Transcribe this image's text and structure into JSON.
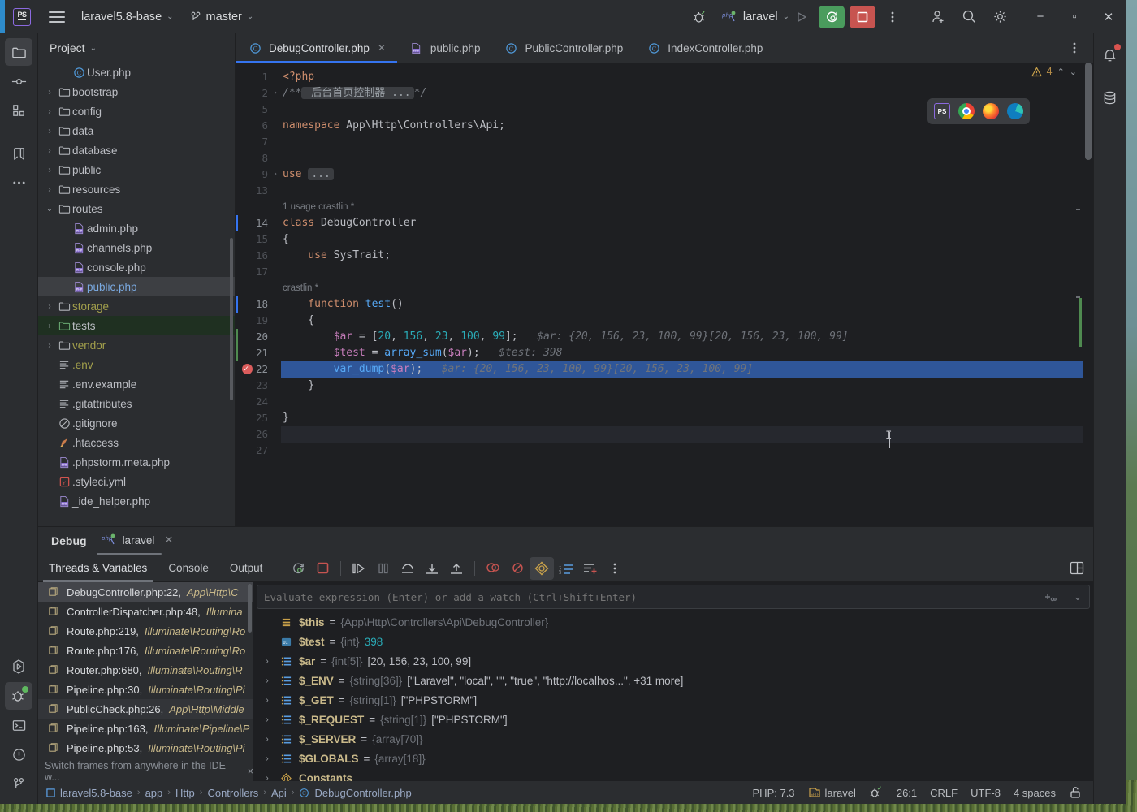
{
  "titlebar": {
    "project_name": "laravel5.8-base",
    "branch": "master",
    "run_config": "laravel",
    "icons": {
      "app_logo": "phpstorm-logo-icon",
      "menu": "hamburger-menu-icon",
      "vcs_branch": "git-branch-icon",
      "debug_settings": "debug-bug-icon",
      "run": "run-icon",
      "rerun_debug": "rerun-debug-icon",
      "stop": "stop-icon",
      "more": "more-vertical-icon",
      "add_user": "add-user-icon",
      "search": "search-icon",
      "settings": "gear-icon",
      "minimize": "minimize-icon",
      "maximize": "maximize-icon",
      "close": "close-icon"
    }
  },
  "left_toolbar": [
    {
      "name": "project",
      "icon": "folder-icon",
      "active": true
    },
    {
      "name": "commit",
      "icon": "commit-icon",
      "active": false
    },
    {
      "name": "structure",
      "icon": "structure-icon",
      "active": false
    },
    {
      "name": "bookmarks",
      "icon": "bookmark-icon",
      "active": false
    },
    {
      "name": "more-tool-windows",
      "icon": "ellipsis-icon",
      "active": false
    }
  ],
  "left_toolbar_bottom": [
    {
      "name": "run",
      "icon": "run-polygon-icon",
      "active": false
    },
    {
      "name": "debug",
      "icon": "debug-bug-icon",
      "active": true
    },
    {
      "name": "terminal",
      "icon": "terminal-icon",
      "active": false
    },
    {
      "name": "problems",
      "icon": "warning-circle-icon",
      "active": false
    },
    {
      "name": "version-control",
      "icon": "git-branch-icon",
      "active": false
    }
  ],
  "right_toolbar": [
    {
      "name": "notifications",
      "icon": "bell-icon"
    },
    {
      "name": "database",
      "icon": "database-icon"
    }
  ],
  "project_panel": {
    "title": "Project",
    "tree": [
      {
        "label": "User.php",
        "indent": 2,
        "arrow": "",
        "icon": "php-class-icon",
        "color": "plain",
        "state": ""
      },
      {
        "label": "bootstrap",
        "indent": 1,
        "arrow": "›",
        "icon": "folder-icon",
        "color": "plain",
        "state": ""
      },
      {
        "label": "config",
        "indent": 1,
        "arrow": "›",
        "icon": "folder-icon",
        "color": "plain",
        "state": ""
      },
      {
        "label": "data",
        "indent": 1,
        "arrow": "›",
        "icon": "folder-icon",
        "color": "plain",
        "state": ""
      },
      {
        "label": "database",
        "indent": 1,
        "arrow": "›",
        "icon": "folder-icon",
        "color": "plain",
        "state": ""
      },
      {
        "label": "public",
        "indent": 1,
        "arrow": "›",
        "icon": "folder-icon",
        "color": "plain",
        "state": ""
      },
      {
        "label": "resources",
        "indent": 1,
        "arrow": "›",
        "icon": "folder-icon",
        "color": "plain",
        "state": ""
      },
      {
        "label": "routes",
        "indent": 1,
        "arrow": "⌄",
        "icon": "folder-icon",
        "color": "plain",
        "state": ""
      },
      {
        "label": "admin.php",
        "indent": 2,
        "arrow": "",
        "icon": "php-file-icon",
        "color": "plain",
        "state": ""
      },
      {
        "label": "channels.php",
        "indent": 2,
        "arrow": "",
        "icon": "php-file-icon",
        "color": "plain",
        "state": ""
      },
      {
        "label": "console.php",
        "indent": 2,
        "arrow": "",
        "icon": "php-file-icon",
        "color": "plain",
        "state": ""
      },
      {
        "label": "public.php",
        "indent": 2,
        "arrow": "",
        "icon": "php-file-icon",
        "color": "blue",
        "state": "sel"
      },
      {
        "label": "storage",
        "indent": 1,
        "arrow": "›",
        "icon": "folder-icon",
        "color": "olive",
        "state": ""
      },
      {
        "label": "tests",
        "indent": 1,
        "arrow": "›",
        "icon": "folder-green-icon",
        "color": "plain",
        "state": "green-hl"
      },
      {
        "label": "vendor",
        "indent": 1,
        "arrow": "›",
        "icon": "folder-icon",
        "color": "olive",
        "state": ""
      },
      {
        "label": ".env",
        "indent": 1,
        "arrow": "",
        "icon": "text-file-icon",
        "color": "olive",
        "state": ""
      },
      {
        "label": ".env.example",
        "indent": 1,
        "arrow": "",
        "icon": "text-file-icon",
        "color": "plain",
        "state": ""
      },
      {
        "label": ".gitattributes",
        "indent": 1,
        "arrow": "",
        "icon": "text-file-icon",
        "color": "plain",
        "state": ""
      },
      {
        "label": ".gitignore",
        "indent": 1,
        "arrow": "",
        "icon": "gitignore-icon",
        "color": "plain",
        "state": ""
      },
      {
        "label": ".htaccess",
        "indent": 1,
        "arrow": "",
        "icon": "htaccess-icon",
        "color": "plain",
        "state": ""
      },
      {
        "label": ".phpstorm.meta.php",
        "indent": 1,
        "arrow": "",
        "icon": "php-file-icon",
        "color": "plain",
        "state": ""
      },
      {
        "label": ".styleci.yml",
        "indent": 1,
        "arrow": "",
        "icon": "yaml-file-icon",
        "color": "plain",
        "state": ""
      },
      {
        "label": "_ide_helper.php",
        "indent": 1,
        "arrow": "",
        "icon": "php-file-icon",
        "color": "plain",
        "state": ""
      }
    ]
  },
  "editor": {
    "tabs": [
      {
        "label": "DebugController.php",
        "icon": "php-class-icon",
        "active": true,
        "closable": true
      },
      {
        "label": "public.php",
        "icon": "php-file-icon",
        "active": false,
        "closable": false
      },
      {
        "label": "PublicController.php",
        "icon": "php-class-icon",
        "active": false,
        "closable": false
      },
      {
        "label": "IndexController.php",
        "icon": "php-class-icon",
        "active": false,
        "closable": false
      }
    ],
    "inspection_count": "4",
    "inspection_icon": "warning-triangle-icon",
    "browser_popup": [
      "phpstorm-icon",
      "chrome-icon",
      "firefox-icon",
      "edge-icon"
    ],
    "lines": [
      {
        "no": "1",
        "fold": "",
        "segments": [
          {
            "t": "<?php",
            "c": "kw"
          }
        ]
      },
      {
        "no": "2",
        "fold": "›",
        "segments": [
          {
            "t": "/**",
            "c": "cmt"
          },
          {
            "t": " 后台首页控制器 ...",
            "c": "foldbadge"
          },
          {
            "t": "*/",
            "c": "cmt"
          }
        ]
      },
      {
        "no": "5",
        "fold": "",
        "segments": []
      },
      {
        "no": "6",
        "fold": "",
        "segments": [
          {
            "t": "namespace ",
            "c": "kw"
          },
          {
            "t": "App\\Http\\Controllers\\Api;",
            "c": "plain"
          }
        ]
      },
      {
        "no": "7",
        "fold": "",
        "segments": []
      },
      {
        "no": "8",
        "fold": "",
        "segments": []
      },
      {
        "no": "9",
        "fold": "›",
        "segments": [
          {
            "t": "use ",
            "c": "kw"
          },
          {
            "t": "...",
            "c": "foldbadge"
          }
        ]
      },
      {
        "no": "13",
        "fold": "",
        "segments": []
      },
      {
        "no": "",
        "fold": "",
        "annot": "1 usage    crastlin *"
      },
      {
        "no": "14",
        "fold": "",
        "mark": "blue",
        "segments": [
          {
            "t": "class ",
            "c": "kw"
          },
          {
            "t": "DebugController",
            "c": "cls"
          }
        ]
      },
      {
        "no": "15",
        "fold": "",
        "segments": [
          {
            "t": "{",
            "c": "plain"
          }
        ]
      },
      {
        "no": "16",
        "fold": "",
        "segments": [
          {
            "t": "    use ",
            "c": "kw"
          },
          {
            "t": "SysTrait;",
            "c": "plain"
          }
        ]
      },
      {
        "no": "17",
        "fold": "",
        "segments": []
      },
      {
        "no": "",
        "fold": "",
        "annot": "   crastlin *"
      },
      {
        "no": "18",
        "fold": "",
        "mark": "blue",
        "segments": [
          {
            "t": "    function ",
            "c": "kw"
          },
          {
            "t": "test",
            "c": "fn"
          },
          {
            "t": "()",
            "c": "plain"
          }
        ]
      },
      {
        "no": "19",
        "fold": "",
        "segments": [
          {
            "t": "    {",
            "c": "plain"
          }
        ]
      },
      {
        "no": "20",
        "fold": "",
        "mark": "green",
        "segments": [
          {
            "t": "        ",
            "c": "plain"
          },
          {
            "t": "$ar",
            "c": "var"
          },
          {
            "t": " = [",
            "c": "plain"
          },
          {
            "t": "20",
            "c": "num"
          },
          {
            "t": ", ",
            "c": "plain"
          },
          {
            "t": "156",
            "c": "num"
          },
          {
            "t": ", ",
            "c": "plain"
          },
          {
            "t": "23",
            "c": "num"
          },
          {
            "t": ", ",
            "c": "plain"
          },
          {
            "t": "100",
            "c": "num"
          },
          {
            "t": ", ",
            "c": "plain"
          },
          {
            "t": "99",
            "c": "num"
          },
          {
            "t": "];",
            "c": "plain"
          },
          {
            "t": "   $ar: {20, 156, 23, 100, 99}[20, 156, 23, 100, 99]",
            "c": "hint"
          }
        ]
      },
      {
        "no": "21",
        "fold": "",
        "mark": "green",
        "segments": [
          {
            "t": "        ",
            "c": "plain"
          },
          {
            "t": "$test",
            "c": "var"
          },
          {
            "t": " = ",
            "c": "plain"
          },
          {
            "t": "array_sum",
            "c": "fn"
          },
          {
            "t": "(",
            "c": "plain"
          },
          {
            "t": "$ar",
            "c": "var"
          },
          {
            "t": ");",
            "c": "plain"
          },
          {
            "t": "   $test: 398",
            "c": "hint"
          }
        ]
      },
      {
        "no": "22",
        "fold": "",
        "breakpoint": true,
        "selected": true,
        "segments": [
          {
            "t": "        ",
            "c": "plain"
          },
          {
            "t": "var_dump",
            "c": "fn"
          },
          {
            "t": "(",
            "c": "plain"
          },
          {
            "t": "$ar",
            "c": "var"
          },
          {
            "t": ");",
            "c": "plain"
          },
          {
            "t": "   $ar: {20, 156, 23, 100, 99}[20, 156, 23, 100, 99]",
            "c": "hint"
          }
        ]
      },
      {
        "no": "23",
        "fold": "",
        "segments": [
          {
            "t": "    }",
            "c": "plain"
          }
        ]
      },
      {
        "no": "24",
        "fold": "",
        "segments": []
      },
      {
        "no": "25",
        "fold": "",
        "segments": [
          {
            "t": "}",
            "c": "plain"
          }
        ]
      },
      {
        "no": "26",
        "fold": "",
        "caret": true,
        "segments": []
      },
      {
        "no": "27",
        "fold": "",
        "segments": []
      }
    ]
  },
  "debug_panel": {
    "title": "Debug",
    "run_tab": "laravel",
    "run_tab_icon": "php-run-icon",
    "tabs": [
      {
        "label": "Threads & Variables",
        "active": true
      },
      {
        "label": "Console",
        "active": false
      },
      {
        "label": "Output",
        "active": false
      }
    ],
    "toolbar_icons": [
      "rerun-icon",
      "stop-icon",
      "resume-icon",
      "pause-icon",
      "step-over-icon",
      "step-into-icon",
      "step-out-icon",
      "view-breakpoints-icon",
      "mute-breakpoints-icon",
      "settings-diamond-icon",
      "sort-values-icon",
      "add-watch-icon",
      "more-vertical-icon"
    ],
    "layout_icon": "layout-settings-icon",
    "evaluate_placeholder": "Evaluate expression (Enter) or add a watch (Ctrl+Shift+Enter)",
    "evaluate_value": "",
    "frames": [
      {
        "file": "DebugController.php:22,",
        "ns": "App\\Http\\C",
        "state": "sel"
      },
      {
        "file": "ControllerDispatcher.php:48,",
        "ns": "Illumina",
        "state": ""
      },
      {
        "file": "Route.php:219,",
        "ns": "Illuminate\\Routing\\Ro",
        "state": ""
      },
      {
        "file": "Route.php:176,",
        "ns": "Illuminate\\Routing\\Ro",
        "state": ""
      },
      {
        "file": "Router.php:680,",
        "ns": "Illuminate\\Routing\\R",
        "state": ""
      },
      {
        "file": "Pipeline.php:30,",
        "ns": "Illuminate\\Routing\\Pi",
        "state": ""
      },
      {
        "file": "PublicCheck.php:26,",
        "ns": "App\\Http\\Middle",
        "state": "alt"
      },
      {
        "file": "Pipeline.php:163,",
        "ns": "Illuminate\\Pipeline\\P",
        "state": ""
      },
      {
        "file": "Pipeline.php:53,",
        "ns": "Illuminate\\Routing\\Pi",
        "state": ""
      }
    ],
    "frames_hint": "Switch frames from anywhere in the IDE w...",
    "frames_hint_close": "×",
    "variables": [
      {
        "arrow": "",
        "icon": "object-icon",
        "name": "$this",
        "type": "{App\\Http\\Controllers\\Api\\DebugController}",
        "value": "",
        "value_class": ""
      },
      {
        "arrow": "",
        "icon": "int-icon",
        "name": "$test",
        "type": "{int}",
        "value": "398",
        "value_class": "num"
      },
      {
        "arrow": "›",
        "icon": "array-icon",
        "name": "$ar",
        "type": "{int[5]}",
        "value": "[20, 156, 23, 100, 99]",
        "value_class": ""
      },
      {
        "arrow": "›",
        "icon": "array-icon",
        "name": "$_ENV",
        "type": "{string[36]}",
        "value": "[\"Laravel\", \"local\", \"\", \"true\", \"http://localhos...\", +31 more]",
        "value_class": ""
      },
      {
        "arrow": "›",
        "icon": "array-icon",
        "name": "$_GET",
        "type": "{string[1]}",
        "value": "[\"PHPSTORM\"]",
        "value_class": ""
      },
      {
        "arrow": "›",
        "icon": "array-icon",
        "name": "$_REQUEST",
        "type": "{string[1]}",
        "value": "[\"PHPSTORM\"]",
        "value_class": ""
      },
      {
        "arrow": "›",
        "icon": "array-icon",
        "name": "$_SERVER",
        "type": "{array[70]}",
        "value": "",
        "value_class": ""
      },
      {
        "arrow": "›",
        "icon": "array-icon",
        "name": "$GLOBALS",
        "type": "{array[18]}",
        "value": "",
        "value_class": ""
      },
      {
        "arrow": "›",
        "icon": "constants-icon",
        "name": "Constants",
        "type": "",
        "value": "",
        "value_class": ""
      }
    ]
  },
  "statusbar": {
    "breadcrumb": [
      "laravel5.8-base",
      "app",
      "Http",
      "Controllers",
      "Api",
      "DebugController.php"
    ],
    "php_version": "PHP: 7.3",
    "deployment": "laravel",
    "deployment_icon": "sftp-icon",
    "debug_listener_icon": "debug-listener-icon",
    "caret_position": "26:1",
    "line_separator": "CRLF",
    "encoding": "UTF-8",
    "indent": "4 spaces",
    "lock_icon": "unlocked-icon"
  }
}
